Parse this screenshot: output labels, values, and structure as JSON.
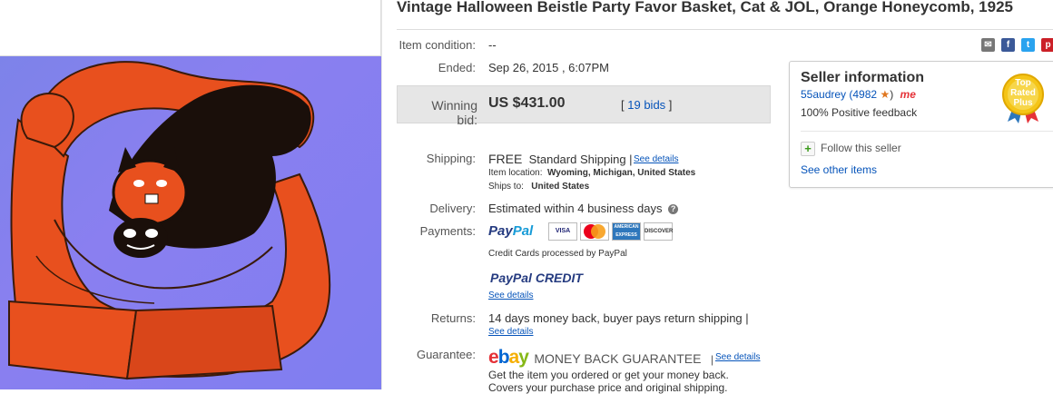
{
  "listing": {
    "title": "Vintage Halloween Beistle Party Favor Basket, Cat & JOL, Orange Honeycomb, 1925"
  },
  "details": {
    "condition_label": "Item condition:",
    "condition_value": "--",
    "ended_label": "Ended:",
    "ended_value": "Sep 26, 2015 , 6:07PM",
    "winning_bid_label": "Winning bid:",
    "winning_bid_value": "US $431.00",
    "bids_open": "[",
    "bids_link": "19 bids",
    "bids_close": "]"
  },
  "shipping": {
    "label": "Shipping:",
    "free": "FREE",
    "method": "Standard Shipping |",
    "see_details": "See details",
    "location_label": "Item location:",
    "location_value": "Wyoming, Michigan, United States",
    "ships_to_label": "Ships to:",
    "ships_to_value": "United States"
  },
  "delivery": {
    "label": "Delivery:",
    "value": "Estimated within 4 business days",
    "help_icon": "?"
  },
  "payments": {
    "label": "Payments:",
    "paypal_1": "Pay",
    "paypal_2": "Pal",
    "cards": [
      "VISA",
      "MasterCard",
      "AMERICAN EXPRESS",
      "DISCOVER"
    ],
    "credit_note": "Credit Cards processed by PayPal",
    "paypal_credit_1": "PayPal",
    "paypal_credit_2": "CREDIT",
    "see_details": "See details"
  },
  "returns": {
    "label": "Returns:",
    "value": "14 days money back, buyer pays return shipping |",
    "see_details": "See details"
  },
  "guarantee": {
    "label": "Guarantee:",
    "logo_e": "e",
    "logo_b": "b",
    "logo_a": "a",
    "logo_y": "y",
    "text": "MONEY BACK GUARANTEE",
    "separator": "|",
    "see_details": "See details",
    "line1": "Get the item you ordered or get your money back.",
    "line2": "Covers your purchase price and original shipping."
  },
  "seller": {
    "title": "Seller information",
    "name": "55audrey",
    "score": "(4982",
    "score_close": ")",
    "me_label": "me",
    "feedback": "100% Positive feedback",
    "follow": "Follow this seller",
    "follow_icon": "+",
    "other_items": "See other items",
    "badge_line1": "Top",
    "badge_line2": "Rated",
    "badge_line3": "Plus"
  },
  "share_icons": [
    "email-icon",
    "facebook-icon",
    "twitter-icon",
    "pinterest-icon"
  ],
  "colors": {
    "link": "#0654ba",
    "bid_box": "#e6e6e6",
    "image_bg": "#7f7ef0",
    "orange": "#e8501e"
  }
}
